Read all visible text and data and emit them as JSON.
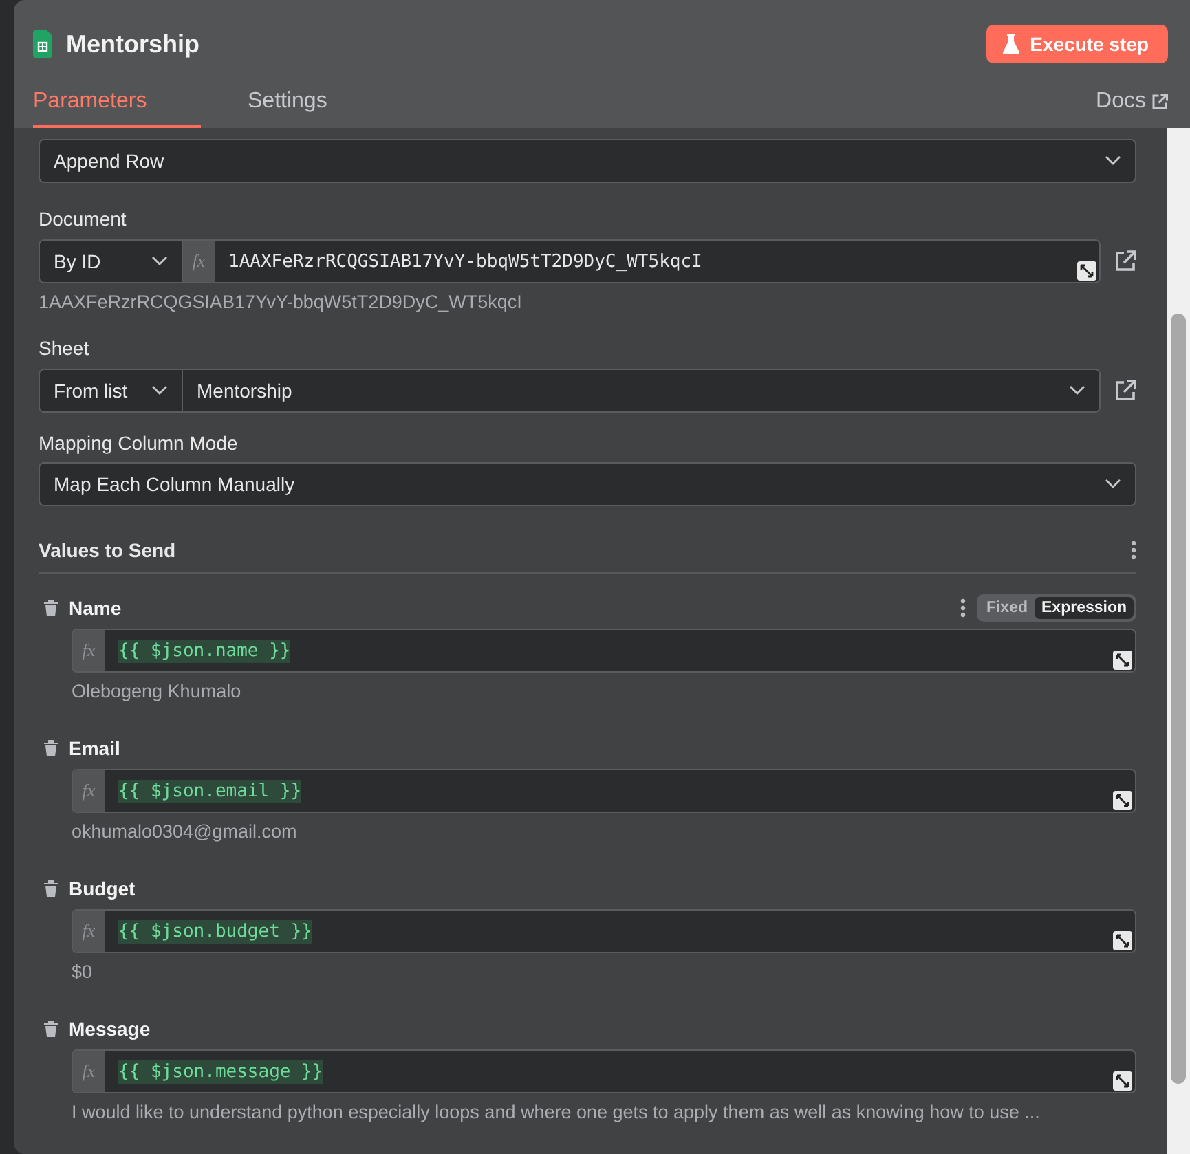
{
  "header": {
    "title": "Mentorship",
    "execute_button": "Execute step"
  },
  "tabs": [
    {
      "label": "Parameters",
      "selected": true
    },
    {
      "label": "Settings",
      "selected": false
    }
  ],
  "docs_link": "Docs",
  "operation": {
    "value": "Append Row"
  },
  "document": {
    "label": "Document",
    "mode": "By ID",
    "value": "1AAXFeRzrRCQGSIAB17YvY-bbqW5tT2D9DyC_WT5kqcI",
    "fx_marker": "fx",
    "hint": "1AAXFeRzrRCQGSIAB17YvY-bbqW5tT2D9DyC_WT5kqcI"
  },
  "sheet": {
    "label": "Sheet",
    "mode": "From list",
    "value": "Mentorship"
  },
  "mapping": {
    "label": "Mapping Column Mode",
    "value": "Map Each Column Manually"
  },
  "values_to_send": {
    "title": "Values to Send",
    "fields": [
      {
        "label": "Name",
        "fx_marker": "fx",
        "expression": "{{ $json.name }}",
        "result": "Olebogeng Khumalo",
        "mode_toggle": [
          {
            "label": "Fixed",
            "selected": false
          },
          {
            "label": "Expression",
            "selected": true
          }
        ]
      },
      {
        "label": "Email",
        "fx_marker": "fx",
        "expression": "{{ $json.email }}",
        "result": "okhumalo0304@gmail.com"
      },
      {
        "label": "Budget",
        "fx_marker": "fx",
        "expression": "{{ $json.budget }}",
        "result": "$0"
      },
      {
        "label": "Message",
        "fx_marker": "fx",
        "expression": "{{ $json.message }}",
        "result": "I would like to understand python especially loops and where one gets to apply them as well as knowing how to use ..."
      }
    ]
  }
}
